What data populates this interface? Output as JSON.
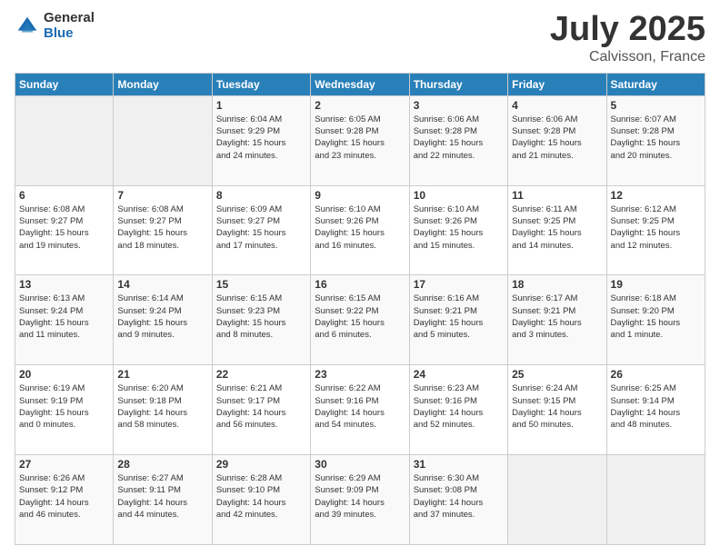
{
  "logo": {
    "general": "General",
    "blue": "Blue"
  },
  "title": {
    "month": "July 2025",
    "location": "Calvisson, France"
  },
  "weekdays": [
    "Sunday",
    "Monday",
    "Tuesday",
    "Wednesday",
    "Thursday",
    "Friday",
    "Saturday"
  ],
  "weeks": [
    [
      {
        "day": "",
        "info": ""
      },
      {
        "day": "",
        "info": ""
      },
      {
        "day": "1",
        "info": "Sunrise: 6:04 AM\nSunset: 9:29 PM\nDaylight: 15 hours\nand 24 minutes."
      },
      {
        "day": "2",
        "info": "Sunrise: 6:05 AM\nSunset: 9:28 PM\nDaylight: 15 hours\nand 23 minutes."
      },
      {
        "day": "3",
        "info": "Sunrise: 6:06 AM\nSunset: 9:28 PM\nDaylight: 15 hours\nand 22 minutes."
      },
      {
        "day": "4",
        "info": "Sunrise: 6:06 AM\nSunset: 9:28 PM\nDaylight: 15 hours\nand 21 minutes."
      },
      {
        "day": "5",
        "info": "Sunrise: 6:07 AM\nSunset: 9:28 PM\nDaylight: 15 hours\nand 20 minutes."
      }
    ],
    [
      {
        "day": "6",
        "info": "Sunrise: 6:08 AM\nSunset: 9:27 PM\nDaylight: 15 hours\nand 19 minutes."
      },
      {
        "day": "7",
        "info": "Sunrise: 6:08 AM\nSunset: 9:27 PM\nDaylight: 15 hours\nand 18 minutes."
      },
      {
        "day": "8",
        "info": "Sunrise: 6:09 AM\nSunset: 9:27 PM\nDaylight: 15 hours\nand 17 minutes."
      },
      {
        "day": "9",
        "info": "Sunrise: 6:10 AM\nSunset: 9:26 PM\nDaylight: 15 hours\nand 16 minutes."
      },
      {
        "day": "10",
        "info": "Sunrise: 6:10 AM\nSunset: 9:26 PM\nDaylight: 15 hours\nand 15 minutes."
      },
      {
        "day": "11",
        "info": "Sunrise: 6:11 AM\nSunset: 9:25 PM\nDaylight: 15 hours\nand 14 minutes."
      },
      {
        "day": "12",
        "info": "Sunrise: 6:12 AM\nSunset: 9:25 PM\nDaylight: 15 hours\nand 12 minutes."
      }
    ],
    [
      {
        "day": "13",
        "info": "Sunrise: 6:13 AM\nSunset: 9:24 PM\nDaylight: 15 hours\nand 11 minutes."
      },
      {
        "day": "14",
        "info": "Sunrise: 6:14 AM\nSunset: 9:24 PM\nDaylight: 15 hours\nand 9 minutes."
      },
      {
        "day": "15",
        "info": "Sunrise: 6:15 AM\nSunset: 9:23 PM\nDaylight: 15 hours\nand 8 minutes."
      },
      {
        "day": "16",
        "info": "Sunrise: 6:15 AM\nSunset: 9:22 PM\nDaylight: 15 hours\nand 6 minutes."
      },
      {
        "day": "17",
        "info": "Sunrise: 6:16 AM\nSunset: 9:21 PM\nDaylight: 15 hours\nand 5 minutes."
      },
      {
        "day": "18",
        "info": "Sunrise: 6:17 AM\nSunset: 9:21 PM\nDaylight: 15 hours\nand 3 minutes."
      },
      {
        "day": "19",
        "info": "Sunrise: 6:18 AM\nSunset: 9:20 PM\nDaylight: 15 hours\nand 1 minute."
      }
    ],
    [
      {
        "day": "20",
        "info": "Sunrise: 6:19 AM\nSunset: 9:19 PM\nDaylight: 15 hours\nand 0 minutes."
      },
      {
        "day": "21",
        "info": "Sunrise: 6:20 AM\nSunset: 9:18 PM\nDaylight: 14 hours\nand 58 minutes."
      },
      {
        "day": "22",
        "info": "Sunrise: 6:21 AM\nSunset: 9:17 PM\nDaylight: 14 hours\nand 56 minutes."
      },
      {
        "day": "23",
        "info": "Sunrise: 6:22 AM\nSunset: 9:16 PM\nDaylight: 14 hours\nand 54 minutes."
      },
      {
        "day": "24",
        "info": "Sunrise: 6:23 AM\nSunset: 9:16 PM\nDaylight: 14 hours\nand 52 minutes."
      },
      {
        "day": "25",
        "info": "Sunrise: 6:24 AM\nSunset: 9:15 PM\nDaylight: 14 hours\nand 50 minutes."
      },
      {
        "day": "26",
        "info": "Sunrise: 6:25 AM\nSunset: 9:14 PM\nDaylight: 14 hours\nand 48 minutes."
      }
    ],
    [
      {
        "day": "27",
        "info": "Sunrise: 6:26 AM\nSunset: 9:12 PM\nDaylight: 14 hours\nand 46 minutes."
      },
      {
        "day": "28",
        "info": "Sunrise: 6:27 AM\nSunset: 9:11 PM\nDaylight: 14 hours\nand 44 minutes."
      },
      {
        "day": "29",
        "info": "Sunrise: 6:28 AM\nSunset: 9:10 PM\nDaylight: 14 hours\nand 42 minutes."
      },
      {
        "day": "30",
        "info": "Sunrise: 6:29 AM\nSunset: 9:09 PM\nDaylight: 14 hours\nand 39 minutes."
      },
      {
        "day": "31",
        "info": "Sunrise: 6:30 AM\nSunset: 9:08 PM\nDaylight: 14 hours\nand 37 minutes."
      },
      {
        "day": "",
        "info": ""
      },
      {
        "day": "",
        "info": ""
      }
    ]
  ]
}
